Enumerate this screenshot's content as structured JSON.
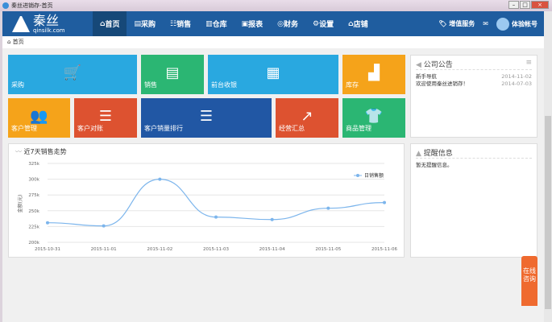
{
  "window": {
    "title": "秦丝进销存-首页"
  },
  "nav": {
    "logo_name": "秦丝",
    "logo_domain": "qinsilk.com",
    "items": [
      {
        "label": "首页",
        "icon": "home-icon"
      },
      {
        "label": "采购",
        "icon": "cart-icon"
      },
      {
        "label": "销售",
        "icon": "sales-icon"
      },
      {
        "label": "仓库",
        "icon": "warehouse-icon"
      },
      {
        "label": "报表",
        "icon": "report-icon"
      },
      {
        "label": "财务",
        "icon": "finance-icon"
      },
      {
        "label": "设置",
        "icon": "settings-icon"
      },
      {
        "label": "店铺",
        "icon": "store-icon"
      }
    ],
    "value_service": "增值服务",
    "account": "体验帐号"
  },
  "breadcrumb": "首页",
  "tiles": [
    {
      "label": "采购",
      "icon": "cart-icon",
      "color": "#29a8e0"
    },
    {
      "label": "销售",
      "icon": "document-icon",
      "color": "#2bb673"
    },
    {
      "label": "前台收银",
      "icon": "cash-register-icon",
      "color": "#29a8e0"
    },
    {
      "label": "库存",
      "icon": "stock-chart-icon",
      "color": "#f5a31a"
    },
    {
      "label": "客户管理",
      "icon": "users-icon",
      "color": "#f5a31a"
    },
    {
      "label": "客户对账",
      "icon": "list-icon",
      "color": "#dd5230"
    },
    {
      "label": "客户销量排行",
      "icon": "bar-rank-icon",
      "color": "#2157a4"
    },
    {
      "label": "经营汇总",
      "icon": "line-chart-icon",
      "color": "#dd5230"
    },
    {
      "label": "商品管理",
      "icon": "clothes-icon",
      "color": "#2bb673"
    }
  ],
  "notice": {
    "title": "公司公告",
    "items": [
      {
        "text": "新手导航",
        "date": "2014-11-02"
      },
      {
        "text": "欢迎使用秦丝进销存！",
        "date": "2014-07-03"
      }
    ]
  },
  "reminder": {
    "title": "提醒信息",
    "empty": "暂无提醒信息。"
  },
  "float_button": "在线咨询",
  "chart_data": {
    "type": "line",
    "title": "近7天销售走势",
    "ylabel": "金额(元)",
    "legend": "日销售额",
    "legend_position": "top-right",
    "x": [
      "2015-10-31",
      "2015-11-01",
      "2015-11-02",
      "2015-11-03",
      "2015-11-04",
      "2015-11-05",
      "2015-11-06"
    ],
    "values": [
      231000,
      226000,
      300000,
      240000,
      236000,
      254000,
      263000
    ],
    "ylim": [
      200000,
      325000
    ],
    "yticks": [
      "200k",
      "225k",
      "250k",
      "275k",
      "300k",
      "325k"
    ],
    "color": "#7cb5ec",
    "grid": true
  }
}
